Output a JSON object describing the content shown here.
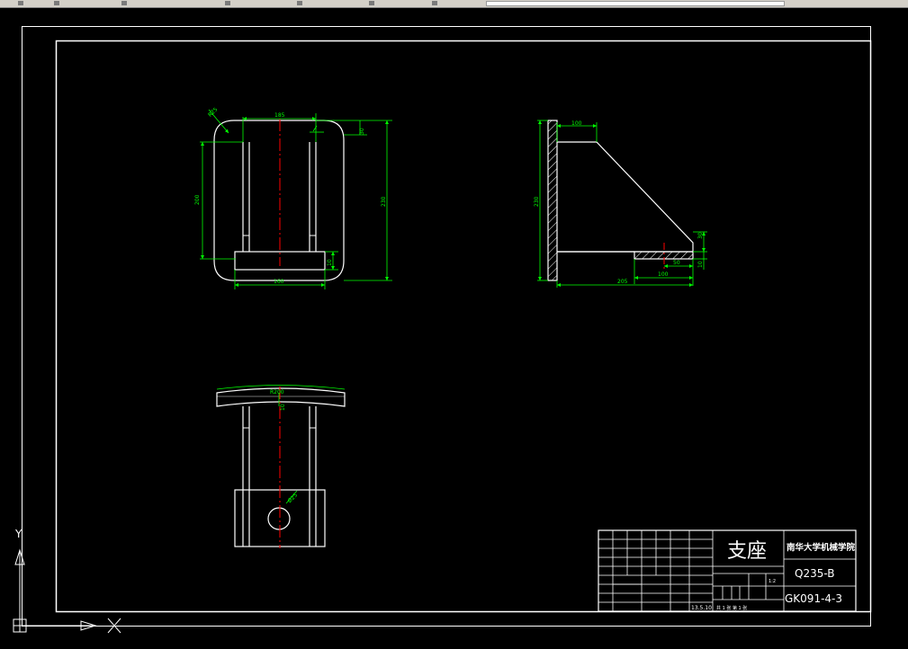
{
  "title_block": {
    "part_name": "支座",
    "institution": "南华大学机械学院",
    "material": "Q235-B",
    "drawing_number": "GK091-4-3",
    "date": "13.5.10",
    "scale": "1:2",
    "sheet_info": "共 1 张  第 1 张"
  },
  "dimensions": {
    "front_top_width": "185",
    "front_corner_radius": "R25",
    "front_right_top": "30",
    "front_left_height": "200",
    "front_total_height": "230",
    "front_base_width": "160",
    "front_base_height": "10",
    "side_top_width": "100",
    "side_left_height": "230",
    "side_right_top": "30",
    "side_base_height": "10",
    "side_base_hole": "50",
    "side_base_width": "100",
    "side_total_width": "205",
    "top_radius": "R200",
    "top_thickness": "10",
    "top_hole": "Ø25"
  },
  "ucs": {
    "y_label": "Y",
    "x_label": "X"
  },
  "colors": {
    "outline": "#ffffff",
    "dimension": "#00ff00",
    "centerline": "#ff0000"
  }
}
